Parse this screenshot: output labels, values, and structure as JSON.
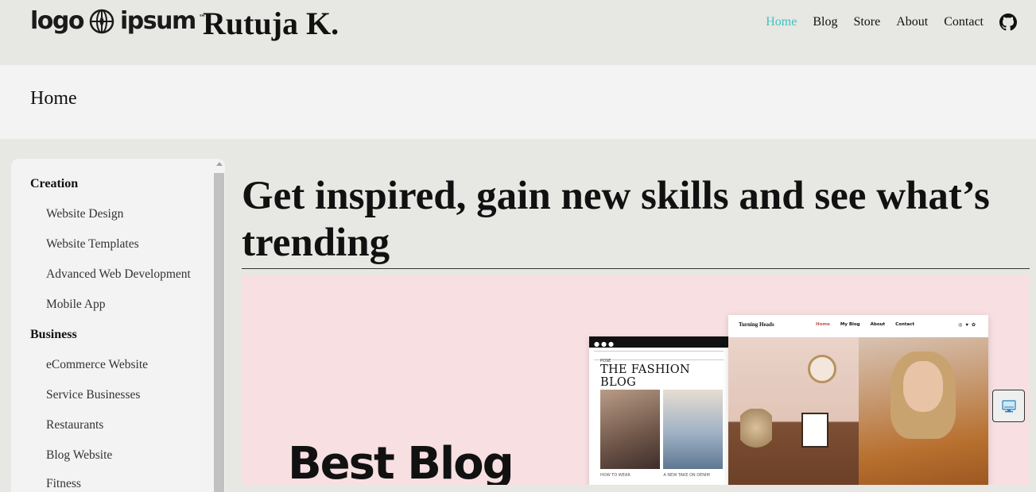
{
  "header": {
    "logo_left": "logo",
    "logo_right": "ipsum",
    "logo_mark": "™",
    "brand": "Rutuja K.",
    "nav": [
      {
        "label": "Home",
        "active": true
      },
      {
        "label": "Blog",
        "active": false
      },
      {
        "label": "Store",
        "active": false
      },
      {
        "label": "About",
        "active": false
      },
      {
        "label": "Contact",
        "active": false
      }
    ],
    "github_icon": "github-icon",
    "active_color": "#3dc3c0"
  },
  "breadcrumb": {
    "current": "Home"
  },
  "sidebar": {
    "groups": [
      {
        "title": "Creation",
        "items": [
          "Website Design",
          "Website Templates",
          "Advanced Web Development",
          "Mobile App"
        ]
      },
      {
        "title": "Business",
        "items": [
          "eCommerce Website",
          "Service Businesses",
          "Restaurants",
          "Blog Website",
          "Fitness"
        ]
      }
    ]
  },
  "main": {
    "headline": "Get inspired, gain new skills and see what’s trending",
    "hero": {
      "title": "Best Blog",
      "background": "#f7dfe2",
      "mock_phone": {
        "blog_title": "THE FASHION BLOG",
        "nav_first": "POSE",
        "caption_1": "HOW TO WEAR",
        "caption_2": "A NEW TAKE ON DENIM"
      },
      "mock_site": {
        "name": "Turning Heads",
        "links": [
          "Home",
          "My Blog",
          "About",
          "Contact"
        ]
      }
    }
  },
  "floating_button": {
    "icon": "desktop-icon"
  }
}
